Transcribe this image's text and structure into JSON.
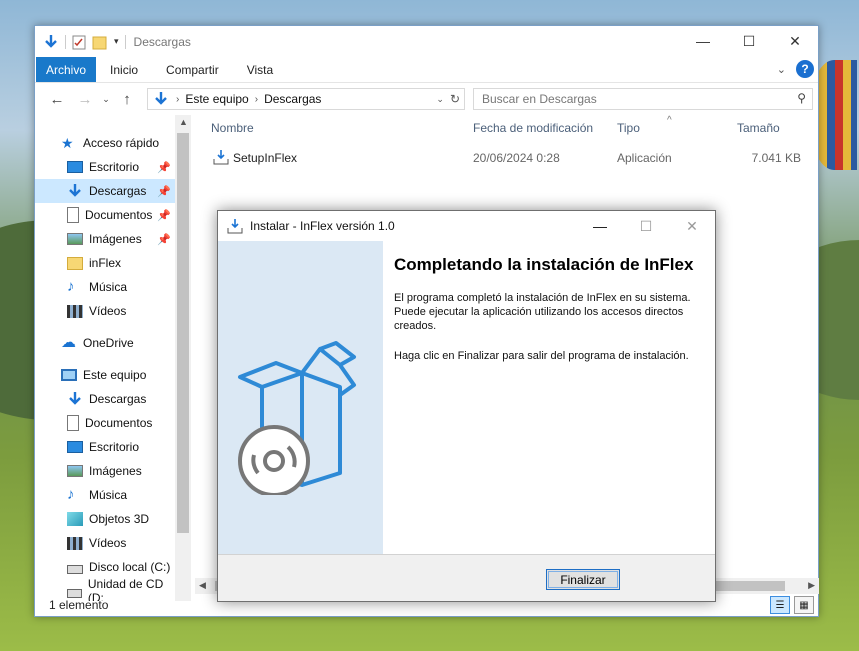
{
  "explorer": {
    "title": "Descargas",
    "ribbon_tabs": [
      "Archivo",
      "Inicio",
      "Compartir",
      "Vista"
    ],
    "address": {
      "crumbs": [
        "Este equipo",
        "Descargas"
      ]
    },
    "search": {
      "placeholder": "Buscar en Descargas"
    },
    "nav": {
      "quick_access": "Acceso rápido",
      "quick_items": [
        "Escritorio",
        "Descargas",
        "Documentos",
        "Imágenes",
        "inFlex",
        "Música",
        "Vídeos"
      ],
      "onedrive": "OneDrive",
      "this_pc": "Este equipo",
      "pc_items": [
        "Descargas",
        "Documentos",
        "Escritorio",
        "Imágenes",
        "Música",
        "Objetos 3D",
        "Vídeos",
        "Disco local (C:)",
        "Unidad de CD (D:"
      ]
    },
    "columns": {
      "name": "Nombre",
      "modified": "Fecha de modificación",
      "type": "Tipo",
      "size": "Tamaño"
    },
    "files": [
      {
        "name": "SetupInFlex",
        "modified": "20/06/2024 0:28",
        "type": "Aplicación",
        "size": "7.041 KB"
      }
    ],
    "status": "1 elemento"
  },
  "dialog": {
    "title": "Instalar - InFlex versión 1.0",
    "heading": "Completando la instalación de InFlex",
    "paragraph1": "El programa completó la instalación de InFlex en su sistema. Puede ejecutar la aplicación utilizando los accesos directos creados.",
    "paragraph2": "Haga clic en Finalizar para salir del programa de instalación.",
    "finish_label": "Finalizar"
  },
  "colors": {
    "accent": "#1979ca",
    "selection": "#cce8ff",
    "dialog_side": "#dbe8f4",
    "box_icon": "#2e8ad6"
  }
}
